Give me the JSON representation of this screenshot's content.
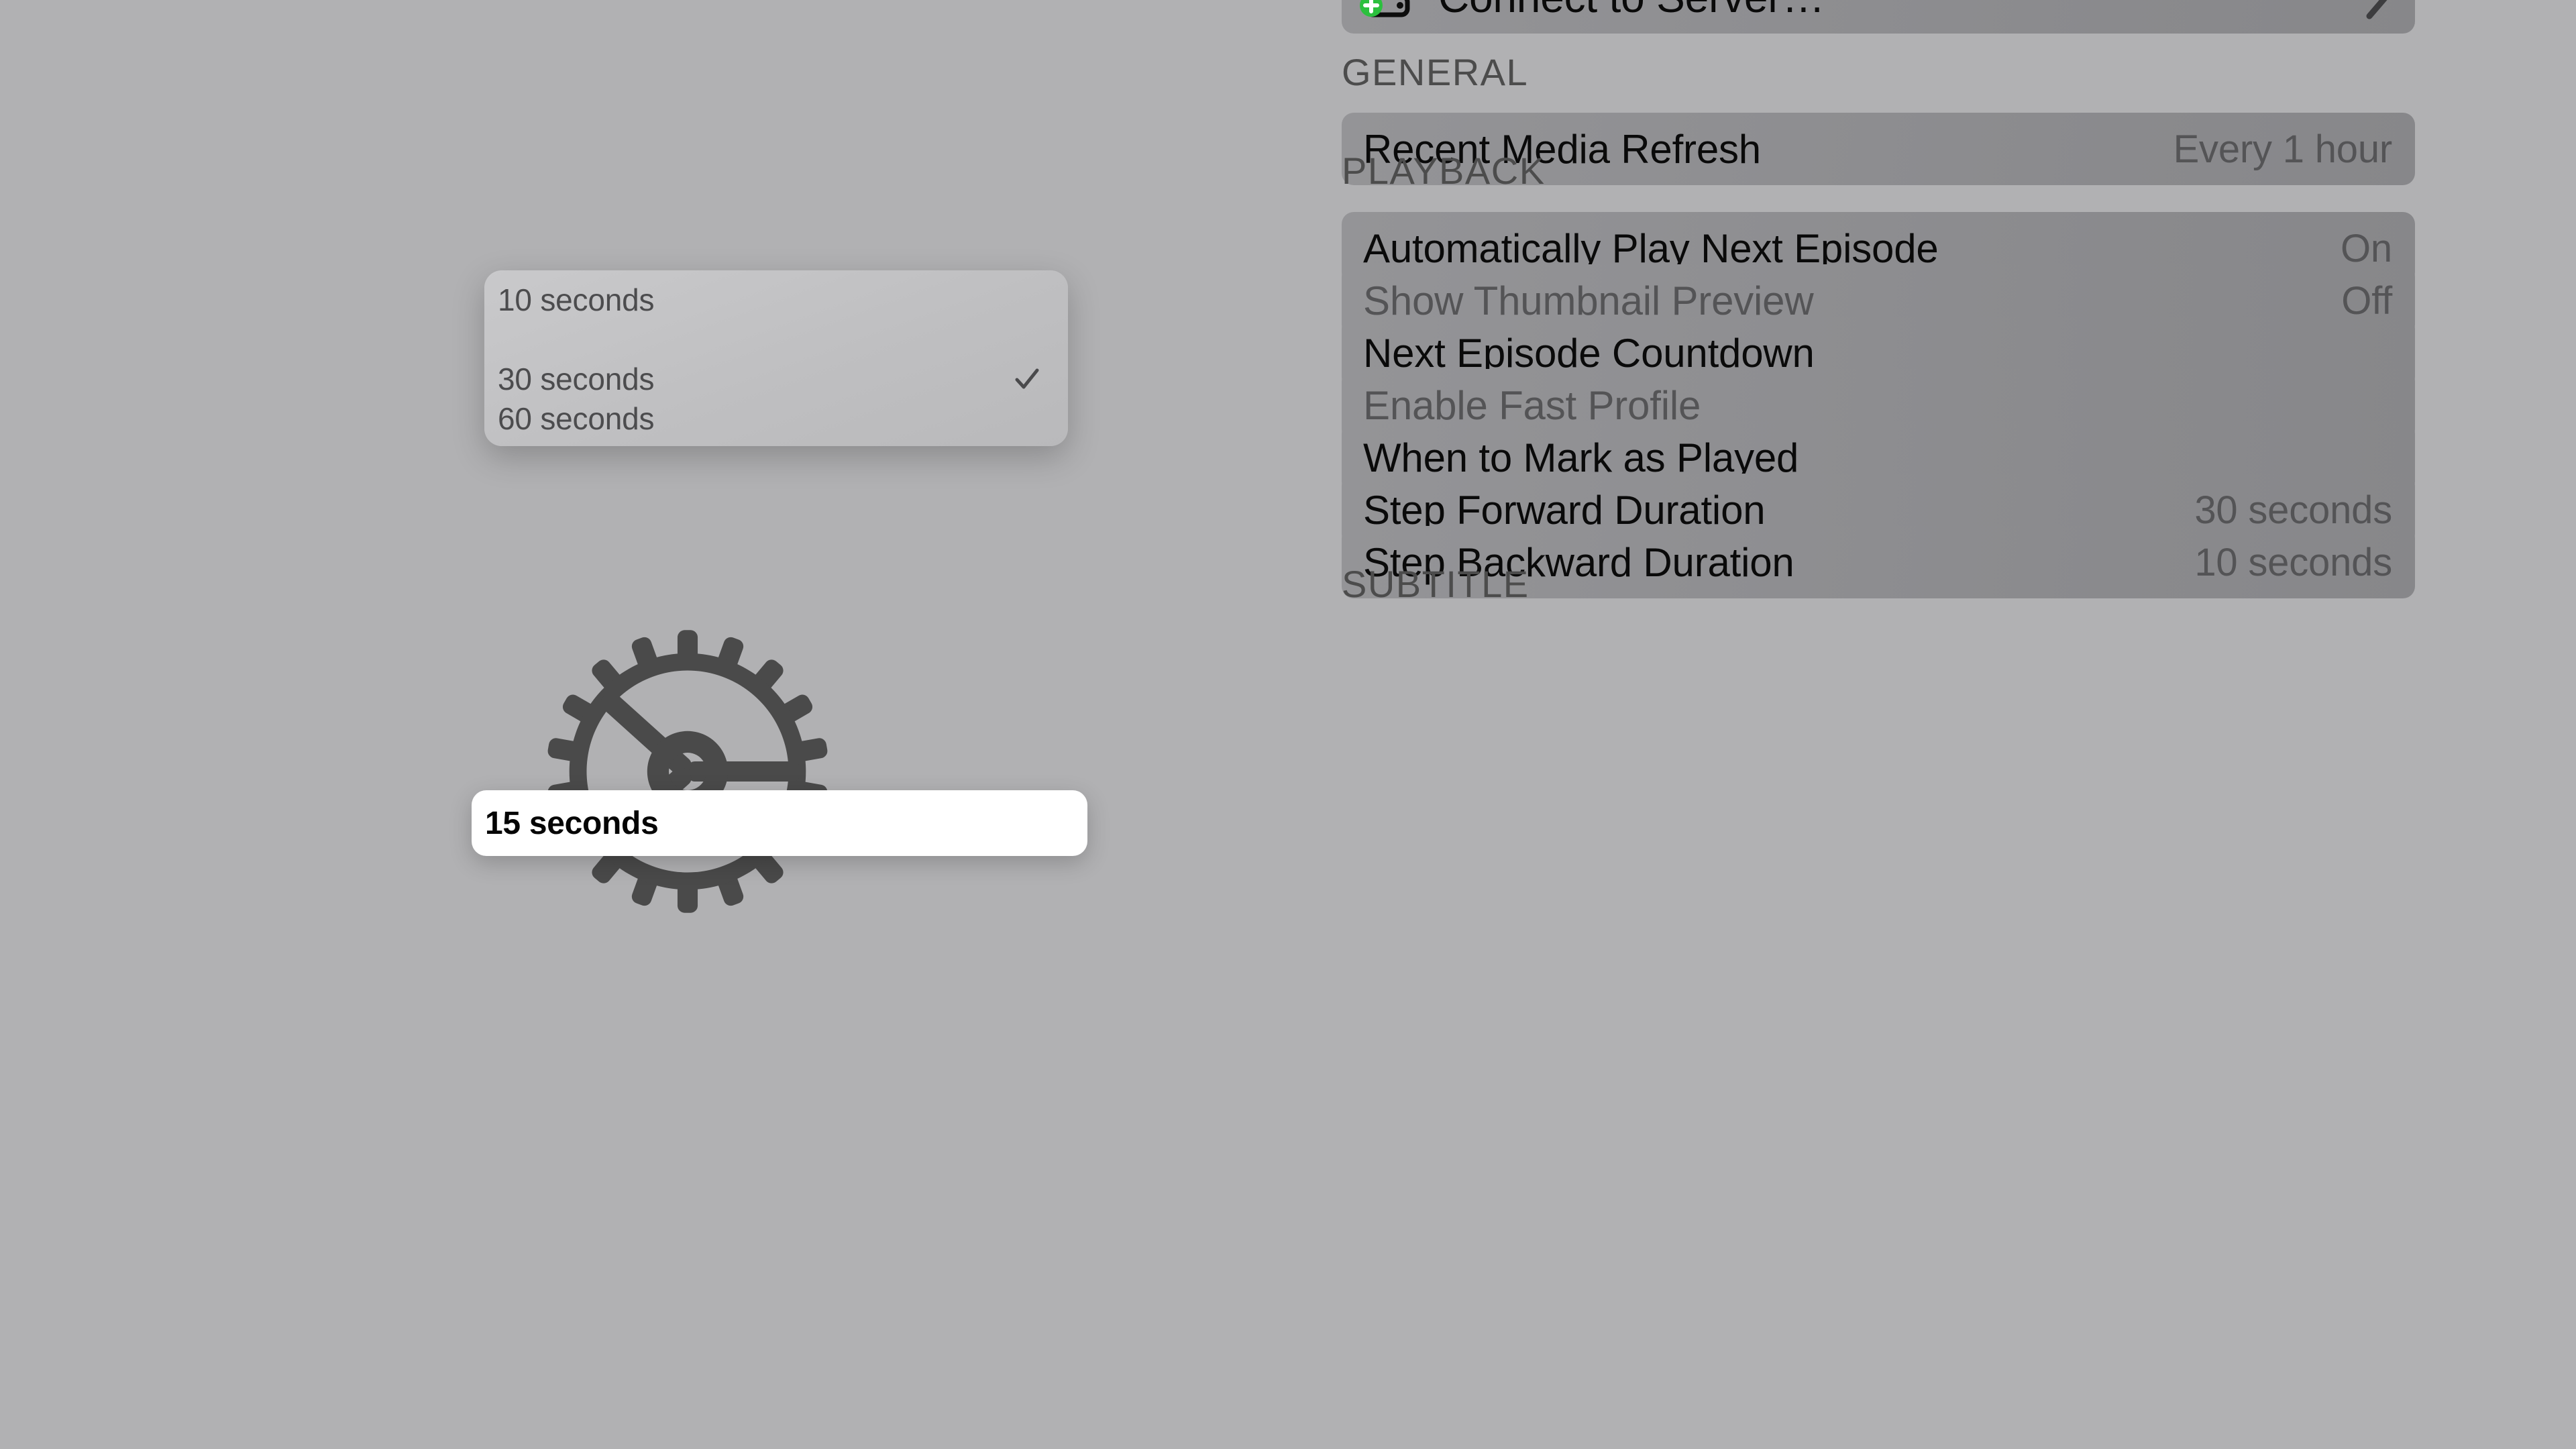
{
  "background_color": "#b1b1b3",
  "left_panel": {
    "icon": "gear-icon",
    "icon_color": "#4a4a4a"
  },
  "settings": {
    "connect_row": {
      "label": "Connect to Server…",
      "icon": "server-add-icon",
      "badge_color": "#2cc03e",
      "accessory": "chevron-right-icon"
    },
    "sections": [
      {
        "header": "GENERAL",
        "rows": [
          {
            "label": "Recent Media Refresh",
            "value": "Every 1 hour",
            "dimmed": false
          }
        ]
      },
      {
        "header": "PLAYBACK",
        "rows": [
          {
            "label": "Automatically Play Next Episode",
            "value": "On",
            "dimmed": false
          },
          {
            "label": "Show Thumbnail Preview",
            "value": "Off",
            "dimmed": true
          },
          {
            "label": "Next Episode Countdown",
            "value": "",
            "dimmed": false
          },
          {
            "label": "Enable Fast Profile",
            "value": "",
            "dimmed": true
          },
          {
            "label": "When to Mark as Played",
            "value": "",
            "dimmed": false
          },
          {
            "label": "Step Forward Duration",
            "value": "30 seconds",
            "dimmed": false
          },
          {
            "label": "Step Backward Duration",
            "value": "10 seconds",
            "dimmed": false
          }
        ]
      },
      {
        "header": "SUBTITLE",
        "rows": []
      }
    ]
  },
  "popup": {
    "title": "",
    "items": [
      {
        "label": "10 seconds",
        "checked": false,
        "focused": false
      },
      {
        "label": "15 seconds",
        "checked": false,
        "focused": true
      },
      {
        "label": "30 seconds",
        "checked": true,
        "focused": false
      },
      {
        "label": "60 seconds",
        "checked": false,
        "focused": false
      }
    ],
    "selected_value": "30 seconds",
    "focused_value": "15 seconds",
    "check_icon": "checkmark-icon"
  }
}
